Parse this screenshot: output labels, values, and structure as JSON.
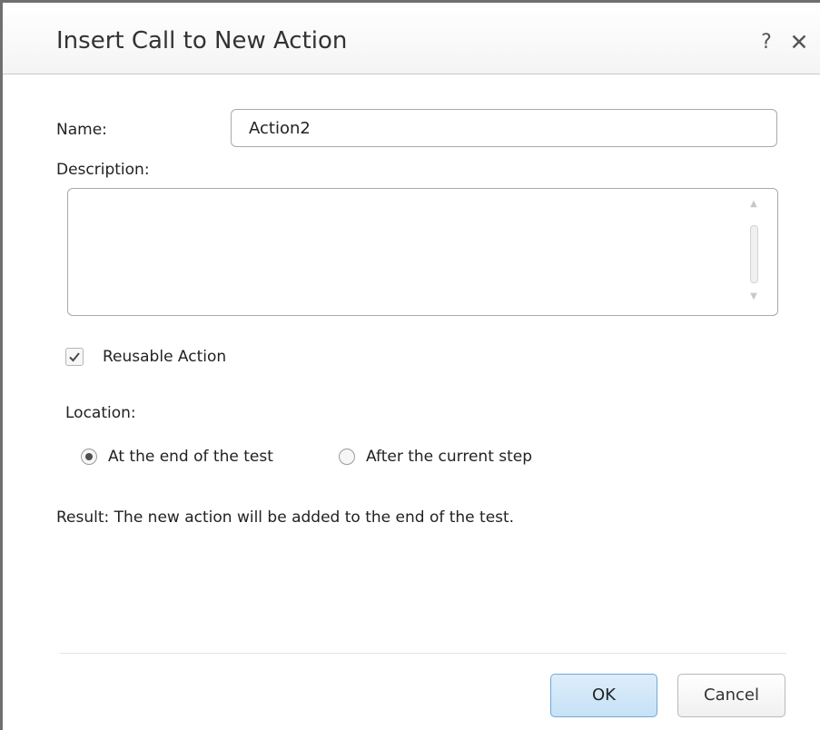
{
  "dialog": {
    "title": "Insert Call to New Action",
    "help_label": "?",
    "close_label": "✕"
  },
  "form": {
    "name_label": "Name:",
    "name_value": "Action2",
    "description_label": "Description:",
    "description_value": "",
    "reusable_label": "Reusable Action",
    "reusable_checked": true,
    "location_label": "Location:",
    "location_options": [
      {
        "label": "At the end of the test",
        "selected": true
      },
      {
        "label": "After the current step",
        "selected": false
      }
    ],
    "result_text": "Result: The new action will be added to the end of the test."
  },
  "buttons": {
    "ok_label": "OK",
    "cancel_label": "Cancel"
  },
  "colors": {
    "ok_border": "#6fa8d6",
    "ok_fill": "#c6e1f6",
    "window_border": "#6f6f6f"
  }
}
